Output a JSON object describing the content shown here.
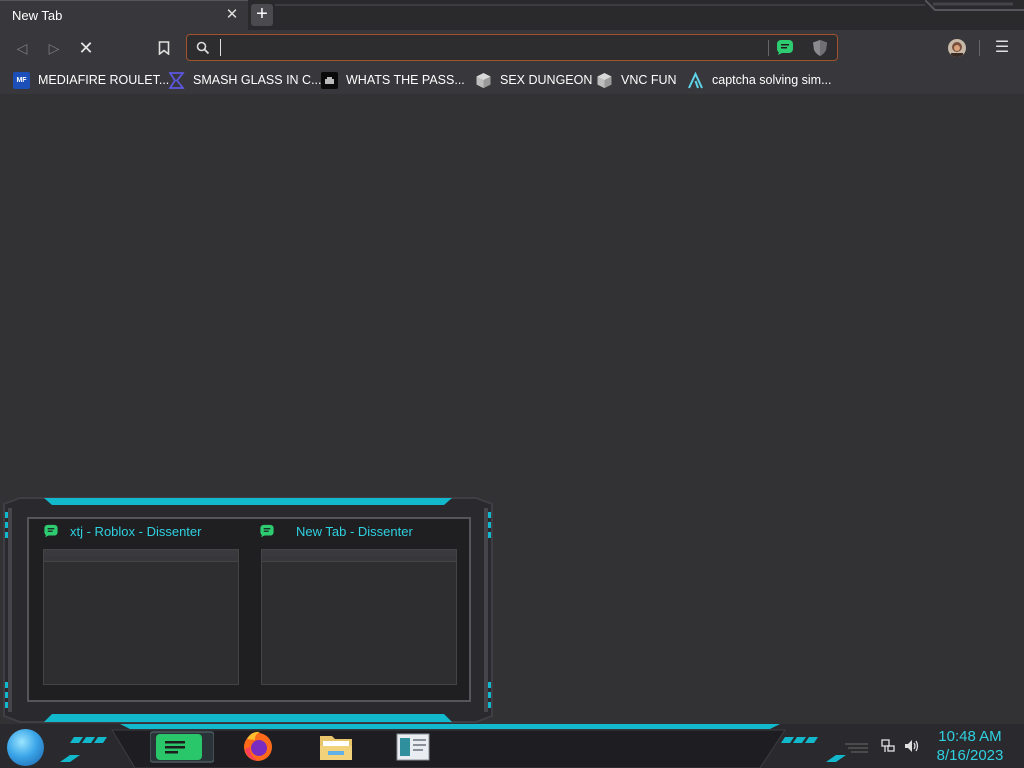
{
  "tab": {
    "title": "New Tab",
    "close": "✕",
    "new_tab": "+"
  },
  "toolbar": {
    "back": "◁",
    "forward": "▷",
    "stop": "✕",
    "bookmark": "🔖",
    "menu": "☰",
    "url_value": "",
    "url_placeholder": ""
  },
  "bookmarks": [
    {
      "label": "MEDIAFIRE ROULET...",
      "icon": "mediafire-icon"
    },
    {
      "label": "SMASH GLASS IN C...",
      "icon": "sigma-icon"
    },
    {
      "label": "WHATS THE PASS...",
      "icon": "chatbot-icon"
    },
    {
      "label": "SEX DUNGEON",
      "icon": "cube-icon"
    },
    {
      "label": "VNC FUN",
      "icon": "cube-icon"
    },
    {
      "label": "captcha solving sim...",
      "icon": "lambda-icon"
    }
  ],
  "popup": {
    "windows": [
      {
        "title": "xtj - Roblox - Dissenter"
      },
      {
        "title": "New Tab - Dissenter"
      }
    ]
  },
  "taskbar": {
    "apps": [
      "dissenter-browser",
      "firefox",
      "file-explorer",
      "notes"
    ],
    "time": "10:48 AM",
    "date": "8/16/2023"
  },
  "colors": {
    "accent": "#2fd0e0",
    "dissenter": "#2ecc71",
    "urlbar_border": "#a0522d"
  }
}
